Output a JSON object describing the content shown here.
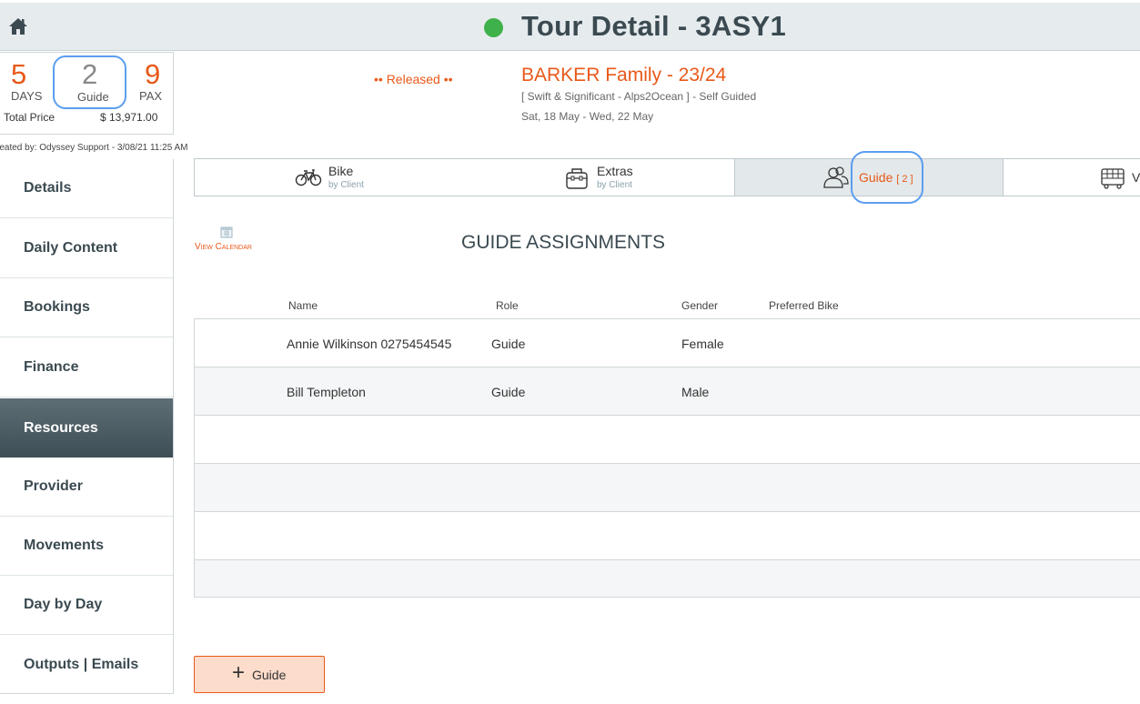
{
  "header": {
    "title": "Tour Detail - 3ASY1",
    "status_color": "#3fb14a"
  },
  "summary": {
    "days_value": "5",
    "days_label": "DAYS",
    "guide_value": "2",
    "guide_label": "Guide",
    "pax_value": "9",
    "pax_label": "PAX",
    "price_label": "Total Price",
    "price_value": "$ 13,971.00",
    "created_by": "reated by: Odyssey Support - 3/08/21 11:25 AM"
  },
  "tour": {
    "status": "•• Released ••",
    "family_title": "BARKER Family - 23/24",
    "subtitle": "[ Swift & Significant - Alps2Ocean ] - Self Guided",
    "dates": "Sat, 18 May  - Wed, 22 May"
  },
  "sidebar": {
    "items": [
      {
        "label": "Details"
      },
      {
        "label": "Daily Content"
      },
      {
        "label": "Bookings"
      },
      {
        "label": "Finance"
      },
      {
        "label": "Resources"
      },
      {
        "label": "Provider"
      },
      {
        "label": "Movements"
      },
      {
        "label": "Day by Day"
      },
      {
        "label": "Outputs | Emails"
      }
    ],
    "active": "Resources"
  },
  "tabs": [
    {
      "label": "Bike",
      "sublabel": "by Client",
      "icon": "bike-icon"
    },
    {
      "label": "Extras",
      "sublabel": "by Client",
      "icon": "bag-icon"
    },
    {
      "label": "Guide",
      "count": "[ 2 ]",
      "icon": "guide-users-icon",
      "active": true
    },
    {
      "label": "V",
      "icon": "bus-icon"
    }
  ],
  "main": {
    "view_calendar": "View Calendar",
    "section_title": "GUIDE ASSIGNMENTS",
    "columns": [
      "Name",
      "Role",
      "Gender",
      "Preferred Bike"
    ],
    "rows": [
      {
        "name": "Annie Wilkinson 0275454545",
        "role": "Guide",
        "gender": "Female",
        "bike": ""
      },
      {
        "name": "Bill Templeton",
        "role": "Guide",
        "gender": "Male",
        "bike": ""
      }
    ],
    "add_button_label": "Guide"
  },
  "colors": {
    "accent": "#e8591a",
    "highlight": "#5b9ef0",
    "sidebar_active": "#4a5a61"
  }
}
